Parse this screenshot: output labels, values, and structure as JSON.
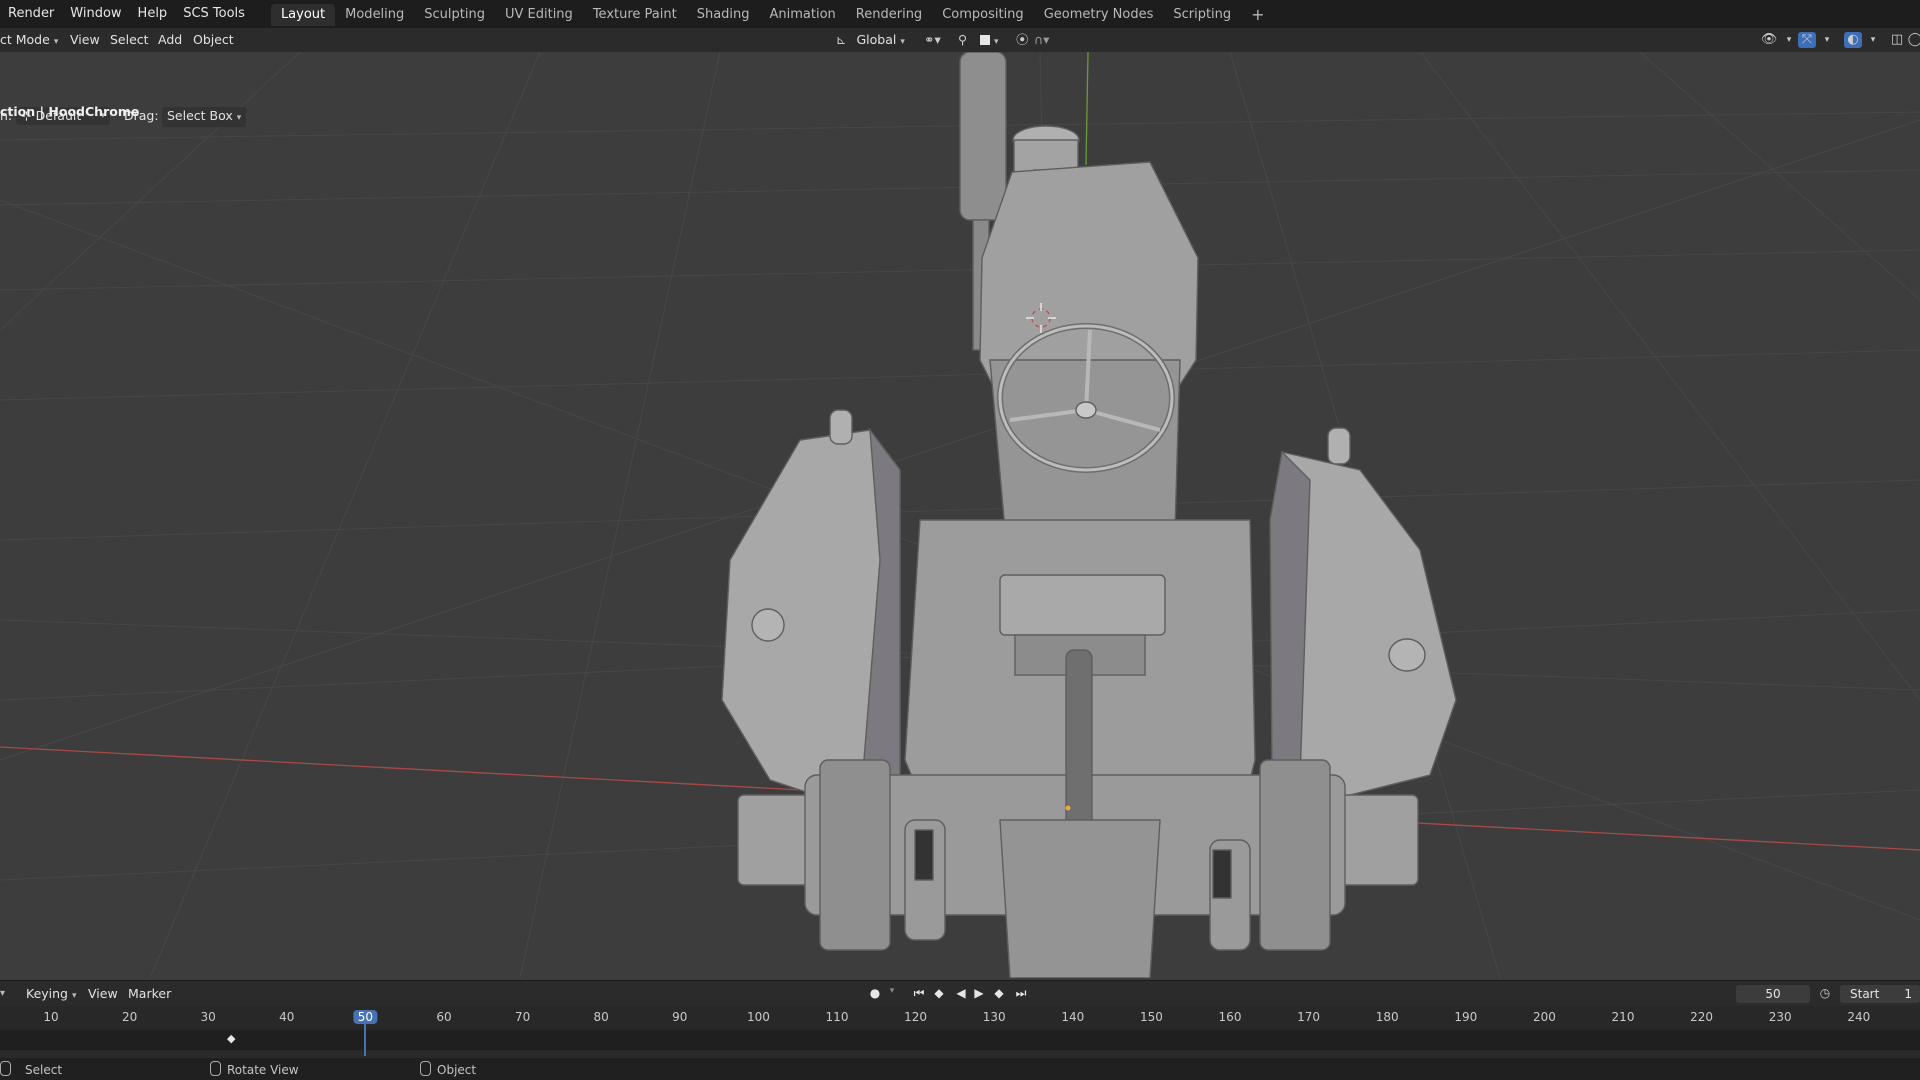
{
  "menubar": {
    "menus": [
      "Render",
      "Window",
      "Help",
      "SCS Tools"
    ],
    "workspaces": [
      "Layout",
      "Modeling",
      "Sculpting",
      "UV Editing",
      "Texture Paint",
      "Shading",
      "Animation",
      "Rendering",
      "Compositing",
      "Geometry Nodes",
      "Scripting"
    ],
    "active_workspace": "Layout",
    "add_label": "+"
  },
  "header": {
    "mode": "ct Mode",
    "view": "View",
    "select": "Select",
    "add": "Add",
    "object": "Object",
    "transform_orientation": "Global",
    "orientation_prefix": "n:",
    "orientation_value": "Default",
    "drag_label": "Drag:",
    "drag_value": "Select Box"
  },
  "viewport": {
    "object_info": "ction | HoodChrome",
    "background_color": "#3d3d3d",
    "model": "tractor"
  },
  "timeline": {
    "keying": "Keying",
    "view": "View",
    "marker": "Marker",
    "current_frame": "50",
    "start_label": "Start",
    "start_value": "1",
    "ruler_ticks": [
      "10",
      "20",
      "30",
      "40",
      "50",
      "60",
      "70",
      "80",
      "90",
      "100",
      "110",
      "120",
      "130",
      "140",
      "150",
      "160",
      "170",
      "180",
      "190",
      "200",
      "210",
      "220",
      "230",
      "240"
    ],
    "playhead_frame": "50",
    "accent": "#4772b3"
  },
  "statusbar": {
    "select": "Select",
    "rotate": "Rotate View",
    "object": "Object"
  }
}
